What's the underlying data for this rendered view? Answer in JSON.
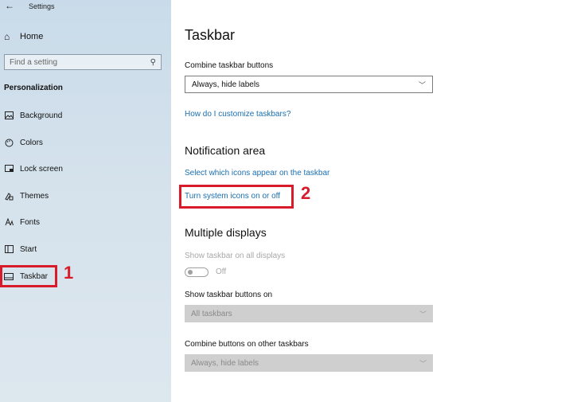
{
  "window": {
    "title": "Settings",
    "back_glyph": "←"
  },
  "sidebar": {
    "home_label": "Home",
    "search_placeholder": "Find a setting",
    "section_label": "Personalization",
    "items": [
      {
        "label": "Background",
        "icon": "image-icon"
      },
      {
        "label": "Colors",
        "icon": "palette-icon"
      },
      {
        "label": "Lock screen",
        "icon": "lock-screen-icon"
      },
      {
        "label": "Themes",
        "icon": "themes-icon"
      },
      {
        "label": "Fonts",
        "icon": "fonts-icon"
      },
      {
        "label": "Start",
        "icon": "start-icon"
      },
      {
        "label": "Taskbar",
        "icon": "taskbar-icon"
      }
    ]
  },
  "annotations": {
    "step1": "1",
    "step2": "2",
    "color": "#d91a2a"
  },
  "main": {
    "title": "Taskbar",
    "combine_label": "Combine taskbar buttons",
    "combine_value": "Always, hide labels",
    "customize_link": "How do I customize taskbars?",
    "notification": {
      "title": "Notification area",
      "link1": "Select which icons appear on the taskbar",
      "link2": "Turn system icons on or off"
    },
    "multiple_displays": {
      "title": "Multiple displays",
      "show_all_label": "Show taskbar on all displays",
      "toggle_state": "Off",
      "show_buttons_label": "Show taskbar buttons on",
      "show_buttons_value": "All taskbars",
      "combine_other_label": "Combine buttons on other taskbars",
      "combine_other_value": "Always, hide labels"
    }
  }
}
